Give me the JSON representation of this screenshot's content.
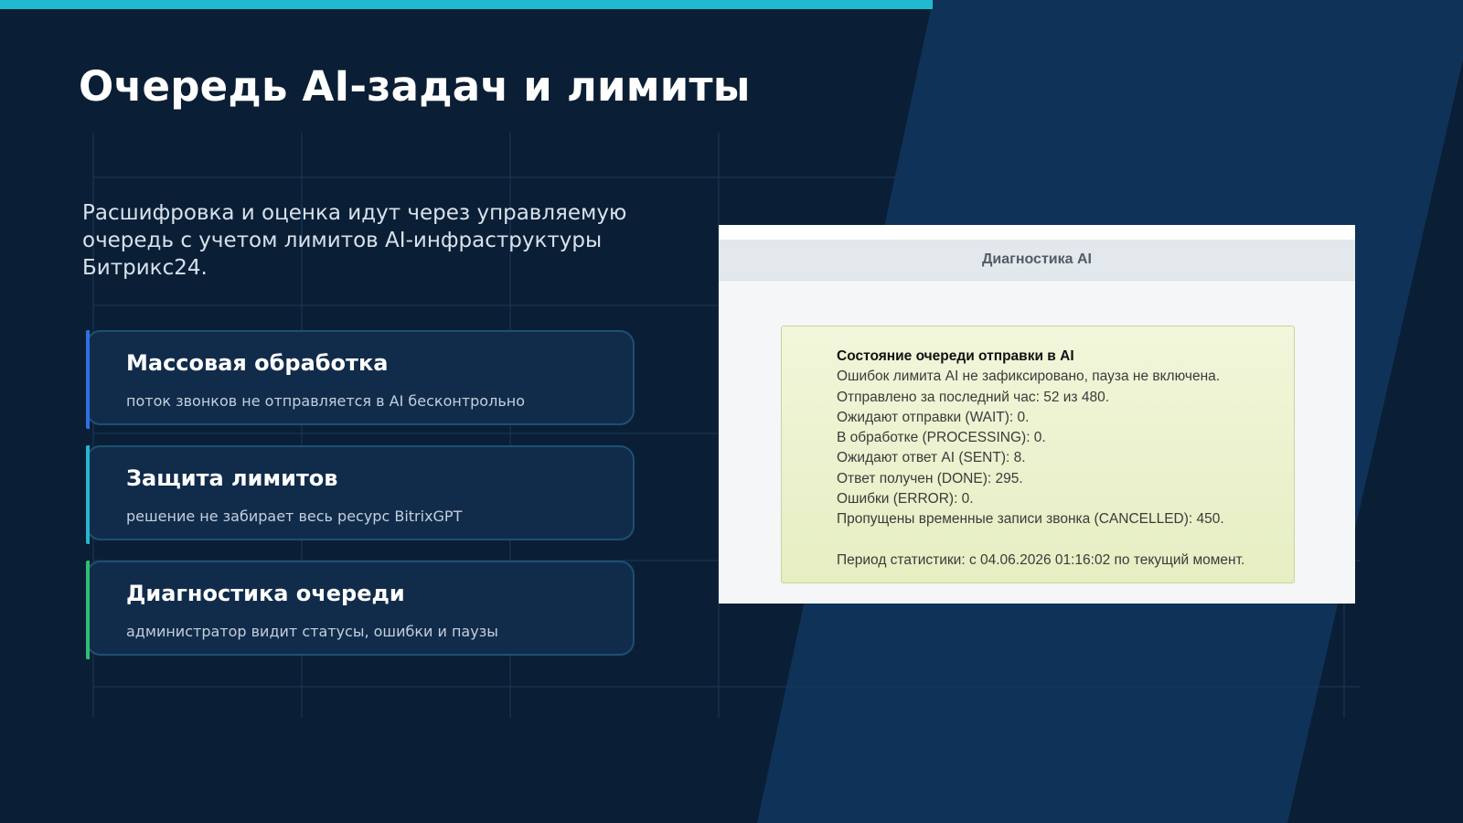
{
  "slide": {
    "title": "Очередь AI-задач и лимиты",
    "subtitle": "Расшифровка и оценка идут через управляемую очередь с учетом лимитов AI-инфраструктуры Битрикс24.",
    "cards": [
      {
        "title": "Массовая обработка",
        "description": "поток звонков не отправляется в AI бесконтрольно",
        "accent_color": "#2f6fe0"
      },
      {
        "title": "Защита лимитов",
        "description": "решение не забирает весь ресурс BitrixGPT",
        "accent_color": "#27b6cf"
      },
      {
        "title": "Диагностика очереди",
        "description": "администратор видит статусы, ошибки и паузы",
        "accent_color": "#2fbf72"
      }
    ]
  },
  "screenshot": {
    "header": "Диагностика AI",
    "status_title": "Состояние очереди отправки в AI",
    "lines": [
      "Ошибок лимита AI не зафиксировано, пауза не включена.",
      "Отправлено за последний час: 52 из 480.",
      "Ожидают отправки (WAIT): 0.",
      "В обработке (PROCESSING): 0.",
      "Ожидают ответ AI (SENT): 8.",
      "Ответ получен (DONE): 295.",
      "Ошибки (ERROR): 0.",
      "Пропущены временные записи звонка (CANCELLED): 450."
    ],
    "period": "Период статистики: с 04.06.2026 01:16:02 по текущий момент."
  },
  "colors": {
    "background": "#0a1f35",
    "diagonal_band": "#0f3258",
    "top_bar": "#1fb8cf",
    "card_background": "#112c4b",
    "status_box": "#e6eec2"
  }
}
